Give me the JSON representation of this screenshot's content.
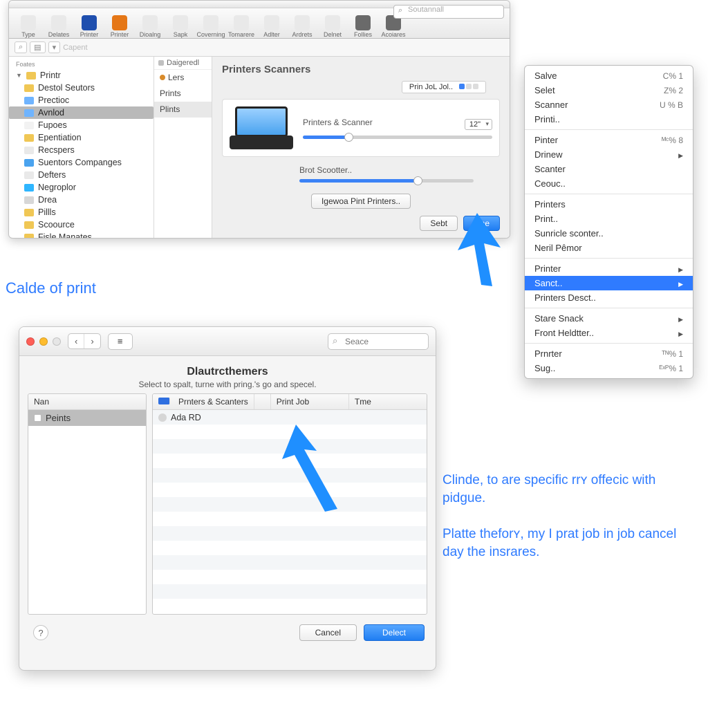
{
  "panelA": {
    "search_placeholder": "Soutannall",
    "toolbar": [
      {
        "label": "Type",
        "color": "#e9e9e9"
      },
      {
        "label": "Delates",
        "color": "#e9e9e9"
      },
      {
        "label": "Printer",
        "color": "#1f4fae"
      },
      {
        "label": "Printer",
        "color": "#e57717"
      },
      {
        "label": "Dioalng",
        "color": "#e9e9e9"
      },
      {
        "label": "Sapk",
        "color": "#e9e9e9"
      },
      {
        "label": "Coverning",
        "color": "#e9e9e9"
      },
      {
        "label": "Tomarere",
        "color": "#e9e9e9"
      },
      {
        "label": "Adlter",
        "color": "#e9e9e9"
      },
      {
        "label": "Ardrets",
        "color": "#e9e9e9"
      },
      {
        "label": "Delnet",
        "color": "#e9e9e9"
      },
      {
        "label": "Follies",
        "color": "#6a6a6a"
      },
      {
        "label": "Acoiares",
        "color": "#6a6a6a"
      }
    ],
    "subtool_label": "Capent",
    "tree_header": "Foates",
    "tree": [
      {
        "label": "Printr",
        "root": true,
        "color": "#f0c755"
      },
      {
        "label": "Destol Seutors",
        "color": "#f0c755"
      },
      {
        "label": "Prectioc",
        "color": "#6fb4ff"
      },
      {
        "label": "Avnlod",
        "sel": true,
        "color": "#6fb4ff"
      },
      {
        "label": "Fupoes",
        "color": "#f2f2f2"
      },
      {
        "label": "Epentiation",
        "color": "#f0c755"
      },
      {
        "label": "Recspers",
        "color": "#e9e9e9"
      },
      {
        "label": "Suentors Companges",
        "color": "#4aa3ef"
      },
      {
        "label": "Defters",
        "color": "#e9e9e9"
      },
      {
        "label": "Negroplor",
        "color": "#2fb6ff"
      },
      {
        "label": "Drea",
        "color": "#d7d7d7"
      },
      {
        "label": "Pillls",
        "color": "#f0c755"
      },
      {
        "label": "Scoource",
        "color": "#f0c755"
      },
      {
        "label": "Fisle Manates",
        "color": "#f0c755"
      }
    ],
    "mid_header": "Daigeredl",
    "mid": [
      {
        "label": "Lers"
      },
      {
        "label": "Prints"
      },
      {
        "label": "Plints",
        "sel": true
      }
    ],
    "title": "Printers Scanners",
    "job_label": "Prin JoL Jol..",
    "row1_label": "Printers & Scanner",
    "row1_select": "12\"",
    "row2_label": "Brot Scootter..",
    "center_btn": "Igewoa Pint Printers..",
    "footer": {
      "cancel": "Sebt",
      "ok": "Tine"
    },
    "slider1": 0.24,
    "slider2": 0.68
  },
  "menu": {
    "groups": [
      [
        {
          "label": "Salve",
          "shortcut": "C% 1"
        },
        {
          "label": "Selet",
          "shortcut": "Z% 2"
        },
        {
          "label": "Scanner",
          "shortcut": "U % B"
        },
        {
          "label": "Printi.."
        }
      ],
      [
        {
          "label": "Pinter",
          "shortcut": "ᴹᶜ% 8"
        },
        {
          "label": "Drinew",
          "submenu": true
        },
        {
          "label": "Scanter"
        },
        {
          "label": "Ceouc.."
        }
      ],
      [
        {
          "label": "Printers"
        },
        {
          "label": "Print.."
        },
        {
          "label": "Sunricle sconter.."
        },
        {
          "label": "Neril Pêmor"
        }
      ],
      [
        {
          "label": "Printer",
          "submenu": true
        },
        {
          "label": "Sanct..",
          "submenu": true,
          "sel": true
        },
        {
          "label": "Printers Desct.."
        }
      ],
      [
        {
          "label": "Stare Snack",
          "submenu": true
        },
        {
          "label": "Front Heldtter..",
          "submenu": true
        }
      ],
      [
        {
          "label": "Prnrter",
          "shortcut": "ᵀᴺ% 1"
        },
        {
          "label": "Sug..",
          "shortcut": "ᴱˣᴾ% 1"
        }
      ]
    ]
  },
  "captions": {
    "c1": "Calde of print",
    "c2": "Clinde, to are specific rrʏ offecic with pidgue.",
    "c3": "Platte theforʏ, my I prat job in job cancel day the insrares."
  },
  "panelB": {
    "traffic": [
      "#ff5f57",
      "#febc2e",
      "#e6e6e6"
    ],
    "nav": [
      "‹",
      "›"
    ],
    "list_icon": "≡",
    "search_placeholder": "Seace",
    "heading": "Dlautrcthemers",
    "subheading": "Select to spalt, turne with pring.'s go and specel.",
    "list_header": "Nan",
    "list_rows": [
      {
        "label": "Peints",
        "sel": true
      }
    ],
    "table_headers": [
      "Prnters & Scanters",
      "Print Job",
      "Tme"
    ],
    "table_rows": [
      {
        "label": "Ada RD"
      }
    ],
    "help": "?",
    "cancel": "Cancel",
    "ok": "Delect"
  }
}
